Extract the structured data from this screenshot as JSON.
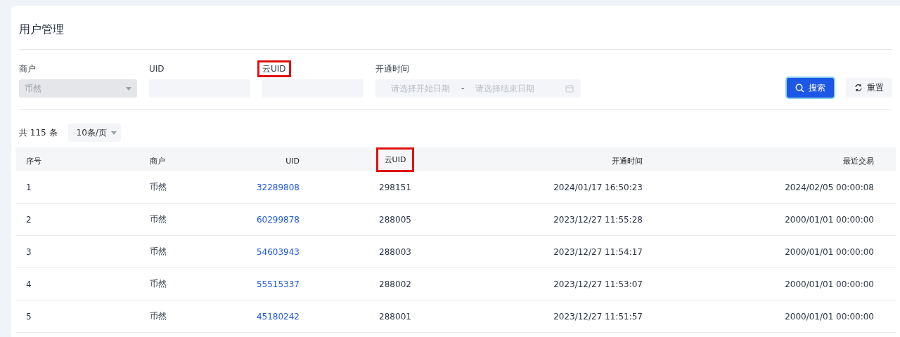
{
  "title": "用户管理",
  "filters": [
    {
      "kind": "select",
      "label": "商户",
      "value": "币然",
      "disabled": true,
      "highlighted": false
    },
    {
      "kind": "input",
      "label": "UID",
      "highlighted": false
    },
    {
      "kind": "input",
      "label": "云UID",
      "highlighted": true
    },
    {
      "kind": "daterange",
      "label": "开通时间",
      "start_placeholder": "请选择开始日期",
      "separator": "-",
      "end_placeholder": "请选择结束日期",
      "highlighted": false
    }
  ],
  "buttons": [
    {
      "kind": "primary",
      "label": "搜索"
    },
    {
      "kind": "default",
      "label": "重置"
    }
  ],
  "total": "共 115 条",
  "page_size": "10条/页",
  "table": {
    "columns": [
      {
        "label": "序号",
        "kind": "text",
        "highlighted": false
      },
      {
        "label": "商户",
        "kind": "text",
        "highlighted": false
      },
      {
        "label": "UID",
        "kind": "link",
        "highlighted": false
      },
      {
        "label": "云UID",
        "kind": "text",
        "highlighted": true
      },
      {
        "label": "开通时间",
        "kind": "text",
        "highlighted": false
      },
      {
        "label": "最近交易",
        "kind": "text",
        "highlighted": false
      }
    ],
    "rows": [
      [
        "1",
        "币然",
        "32289808",
        "298151",
        "2024/01/17 16:50:23",
        "2024/02/05 00:00:08"
      ],
      [
        "2",
        "币然",
        "60299878",
        "288005",
        "2023/12/27 11:55:28",
        "2000/01/01 00:00:00"
      ],
      [
        "3",
        "币然",
        "54603943",
        "288003",
        "2023/12/27 11:54:17",
        "2000/01/01 00:00:00"
      ],
      [
        "4",
        "币然",
        "55515337",
        "288002",
        "2023/12/27 11:53:07",
        "2000/01/01 00:00:00"
      ],
      [
        "5",
        "币然",
        "45180242",
        "288001",
        "2023/12/27 11:51:57",
        "2000/01/01 00:00:00"
      ]
    ]
  }
}
